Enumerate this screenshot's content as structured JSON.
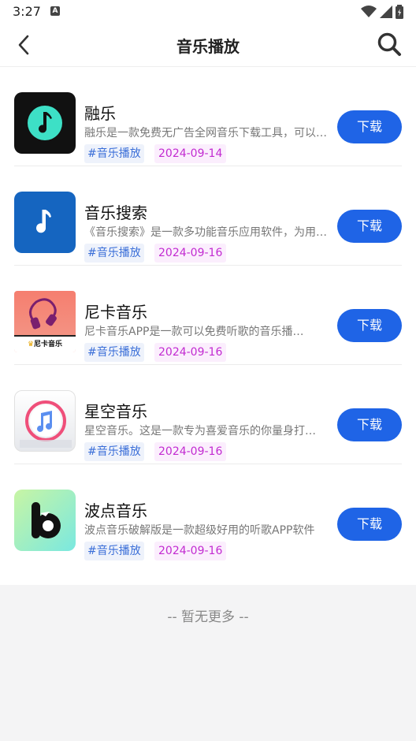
{
  "status": {
    "time": "3:27",
    "notif_icon": "A"
  },
  "header": {
    "title": "音乐播放"
  },
  "apps": [
    {
      "name": "融乐",
      "desc": "融乐是一款免费无广告全网音乐下载工具，可以让你免费下载全网音乐",
      "tag": "#音乐播放",
      "date": "2024-09-14",
      "button": "下载"
    },
    {
      "name": "音乐搜索",
      "desc": "《音乐搜索》是一款多功能音乐应用软件，为用户提供海量音乐资源",
      "tag": "#音乐播放",
      "date": "2024-09-16",
      "button": "下载"
    },
    {
      "name": "尼卡音乐",
      "desc": "尼卡音乐APP是一款可以免费听歌的音乐播放软件",
      "tag": "#音乐播放",
      "date": "2024-09-16",
      "button": "下载",
      "icon_label": "尼卡音乐"
    },
    {
      "name": "星空音乐",
      "desc": "星空音乐。这是一款专为喜爱音乐的你量身打造的音乐软件",
      "tag": "#音乐播放",
      "date": "2024-09-16",
      "button": "下载"
    },
    {
      "name": "波点音乐",
      "desc": "波点音乐破解版是一款超级好用的听歌APP软件",
      "tag": "#音乐播放",
      "date": "2024-09-16",
      "button": "下载"
    }
  ],
  "footer": {
    "text": "-- 暂无更多 --"
  }
}
